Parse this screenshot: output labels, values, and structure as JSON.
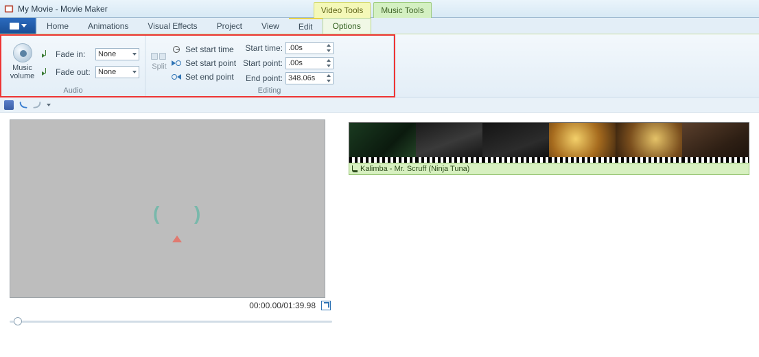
{
  "titlebar": {
    "title": "My Movie - Movie Maker"
  },
  "contextual_tabs": {
    "video": "Video Tools",
    "music": "Music Tools"
  },
  "tabs": {
    "home": "Home",
    "animations": "Animations",
    "visual_effects": "Visual Effects",
    "project": "Project",
    "view": "View",
    "edit": "Edit",
    "options": "Options"
  },
  "ribbon": {
    "audio_group_label": "Audio",
    "editing_group_label": "Editing",
    "music_volume_label": "Music volume",
    "fade_in_label": "Fade in:",
    "fade_out_label": "Fade out:",
    "fade_in_value": "None",
    "fade_out_value": "None",
    "split_label": "Split",
    "set_start_time": "Set start time",
    "set_start_point": "Set start point",
    "set_end_point": "Set end point",
    "start_time_label": "Start time:",
    "start_point_label": "Start point:",
    "end_point_label": "End point:",
    "start_time_value": ".00s",
    "start_point_value": ".00s",
    "end_point_value": "348.06s"
  },
  "preview": {
    "time_display": "00:00.00/01:39.98"
  },
  "audio_track": {
    "label": "Kalimba - Mr. Scruff (Ninja Tuna)"
  }
}
